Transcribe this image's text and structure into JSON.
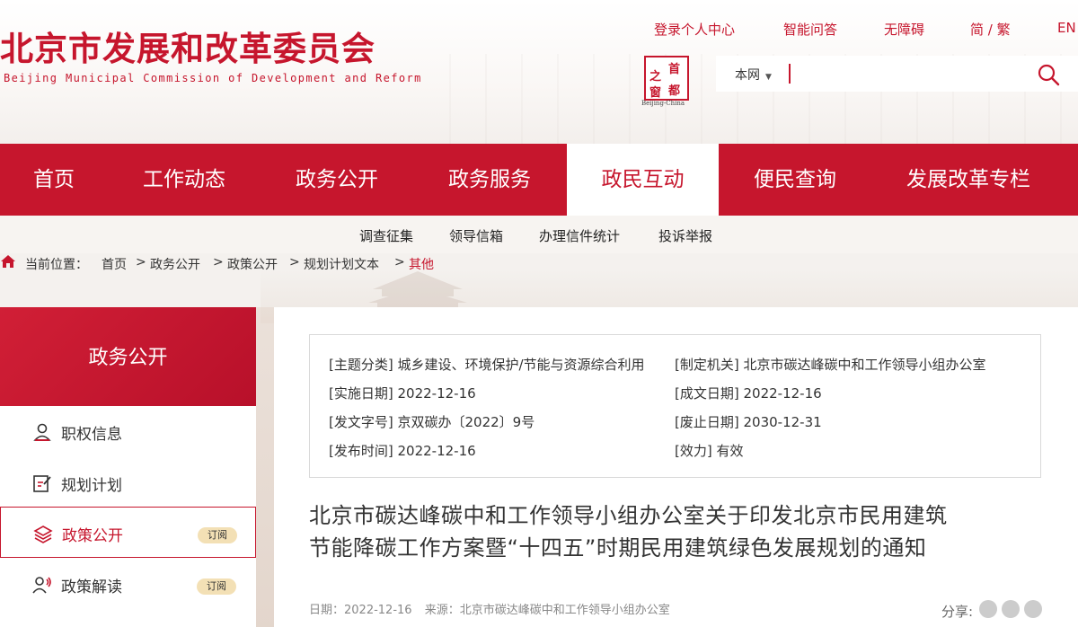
{
  "header": {
    "title": "北京市发展和改革委员会",
    "subtitle": "Beijing Municipal Commission of Development and Reform",
    "toplinks": {
      "personal_center": "登录个人中心",
      "smart_qa": "智能问答",
      "accessibility": "无障碍",
      "simp_trad": "简 / 繁",
      "english": "EN"
    },
    "seal": {
      "chars": [
        "首",
        "之",
        "都",
        "窗"
      ],
      "caption": "Beijing-China"
    },
    "search": {
      "scope": "本网",
      "placeholder": ""
    }
  },
  "nav": {
    "items": [
      {
        "label": "首页"
      },
      {
        "label": "工作动态"
      },
      {
        "label": "政务公开"
      },
      {
        "label": "政务服务"
      },
      {
        "label": "政民互动"
      },
      {
        "label": "便民查询"
      },
      {
        "label": "发展改革专栏"
      }
    ],
    "active_index": 4,
    "subitems": [
      "调查征集",
      "领导信箱",
      "办理信件统计",
      "投诉举报"
    ]
  },
  "breadcrumb": {
    "label": "当前位置：",
    "items": [
      "首页",
      "政务公开",
      "政策公开",
      "规划计划文本",
      "其他"
    ],
    "separator": ">"
  },
  "sidebar": {
    "heading": "政务公开",
    "items": [
      {
        "label": "职权信息"
      },
      {
        "label": "规划计划"
      },
      {
        "label": "政策公开",
        "badge": "订阅",
        "active": true
      },
      {
        "label": "政策解读",
        "badge": "订阅"
      }
    ]
  },
  "meta": {
    "topic": {
      "key": "[主题分类]",
      "value": "城乡建设、环境保护/节能与资源综合利用"
    },
    "issuer": {
      "key": "[制定机关]",
      "value": "北京市碳达峰碳中和工作领导小组办公室"
    },
    "effective_date": {
      "key": "[实施日期]",
      "value": "2022-12-16"
    },
    "written_date": {
      "key": "[成文日期]",
      "value": "2022-12-16"
    },
    "doc_number": {
      "key": "[发文字号]",
      "value": "京双碳办〔2022〕9号"
    },
    "expiry_date": {
      "key": "[废止日期]",
      "value": "2030-12-31"
    },
    "publish_time": {
      "key": "[发布时间]",
      "value": "2022-12-16"
    },
    "validity": {
      "key": "[效力]",
      "value": "有效"
    }
  },
  "article": {
    "title_line1": "北京市碳达峰碳中和工作领导小组办公室关于印发北京市民用建筑",
    "title_line2": "节能降碳工作方案暨“十四五”时期民用建筑绿色发展规划的通知",
    "date_label": "日期：2022-12-16",
    "source_label": "来源：北京市碳达峰碳中和工作领导小组办公室",
    "share_label": "分享:"
  },
  "colors": {
    "brand_red": "#c6162d",
    "badge_gold": "#f3e0b5"
  }
}
